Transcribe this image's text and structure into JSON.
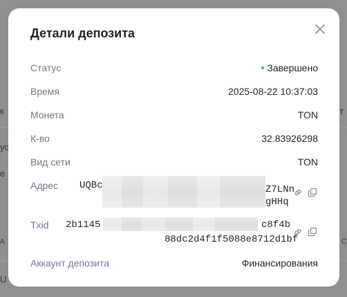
{
  "background": {
    "fragments": [
      "к",
      "т",
      "ус",
      "е",
      "А",
      "С",
      "U"
    ]
  },
  "modal": {
    "title": "Детали депозита",
    "rows": [
      {
        "label": "Статус",
        "value": "Завершено",
        "status_color": "#2ebd85"
      },
      {
        "label": "Время",
        "value": "2025-08-22 10:37:03"
      },
      {
        "label": "Монета",
        "value": "TON"
      },
      {
        "label": "К-во",
        "value": "32.83926298"
      },
      {
        "label": "Вид сети",
        "value": "TON"
      },
      {
        "label": "Адрес",
        "line1_start": "UQBc",
        "line1_end": "Z7LNn",
        "line2_end": "gHHq"
      },
      {
        "label": "Txid",
        "line1_start": "2b1145",
        "line1_end": "c8f4b",
        "line2": "88dc2d4f1f5088e8712d1bf"
      },
      {
        "label": "Аккаунт депозита",
        "value": "Финансирования"
      }
    ]
  },
  "icons": {
    "close": "close-icon",
    "link": "link-icon",
    "copy": "copy-icon"
  },
  "colors": {
    "overlay": "#8f8f8f",
    "label": "#707a8a",
    "text": "#1e2329",
    "success": "#2ebd85"
  }
}
